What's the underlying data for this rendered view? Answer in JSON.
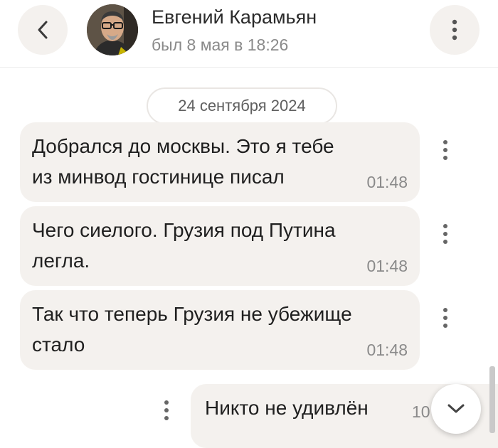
{
  "header": {
    "contact_name": "Евгений Карамьян",
    "last_seen": "был 8 мая в 18:26"
  },
  "chat": {
    "date_separator": "24 сентября 2024",
    "messages": [
      {
        "text": "Добрался до москвы. Это я тебе из минвод гостинице писал",
        "time": "01:48",
        "direction": "incoming"
      },
      {
        "text": "Чего сиелого. Грузия под Путина легла.",
        "time": "01:48",
        "direction": "incoming"
      },
      {
        "text": "Так что теперь Грузия не убежище стало",
        "time": "01:48",
        "direction": "incoming"
      },
      {
        "text": "Никто не удивлён",
        "time": "10",
        "direction": "outgoing"
      }
    ]
  },
  "icons": {
    "back": "chevron-left-icon",
    "menu": "more-vertical-icon",
    "message_menu": "more-vertical-icon",
    "scroll_down": "chevron-down-icon"
  },
  "colors": {
    "bubble_bg": "#f4f1ee",
    "button_bg": "#f4f1ee",
    "text": "#1f1f1f",
    "muted_text": "#8a8a8a"
  }
}
